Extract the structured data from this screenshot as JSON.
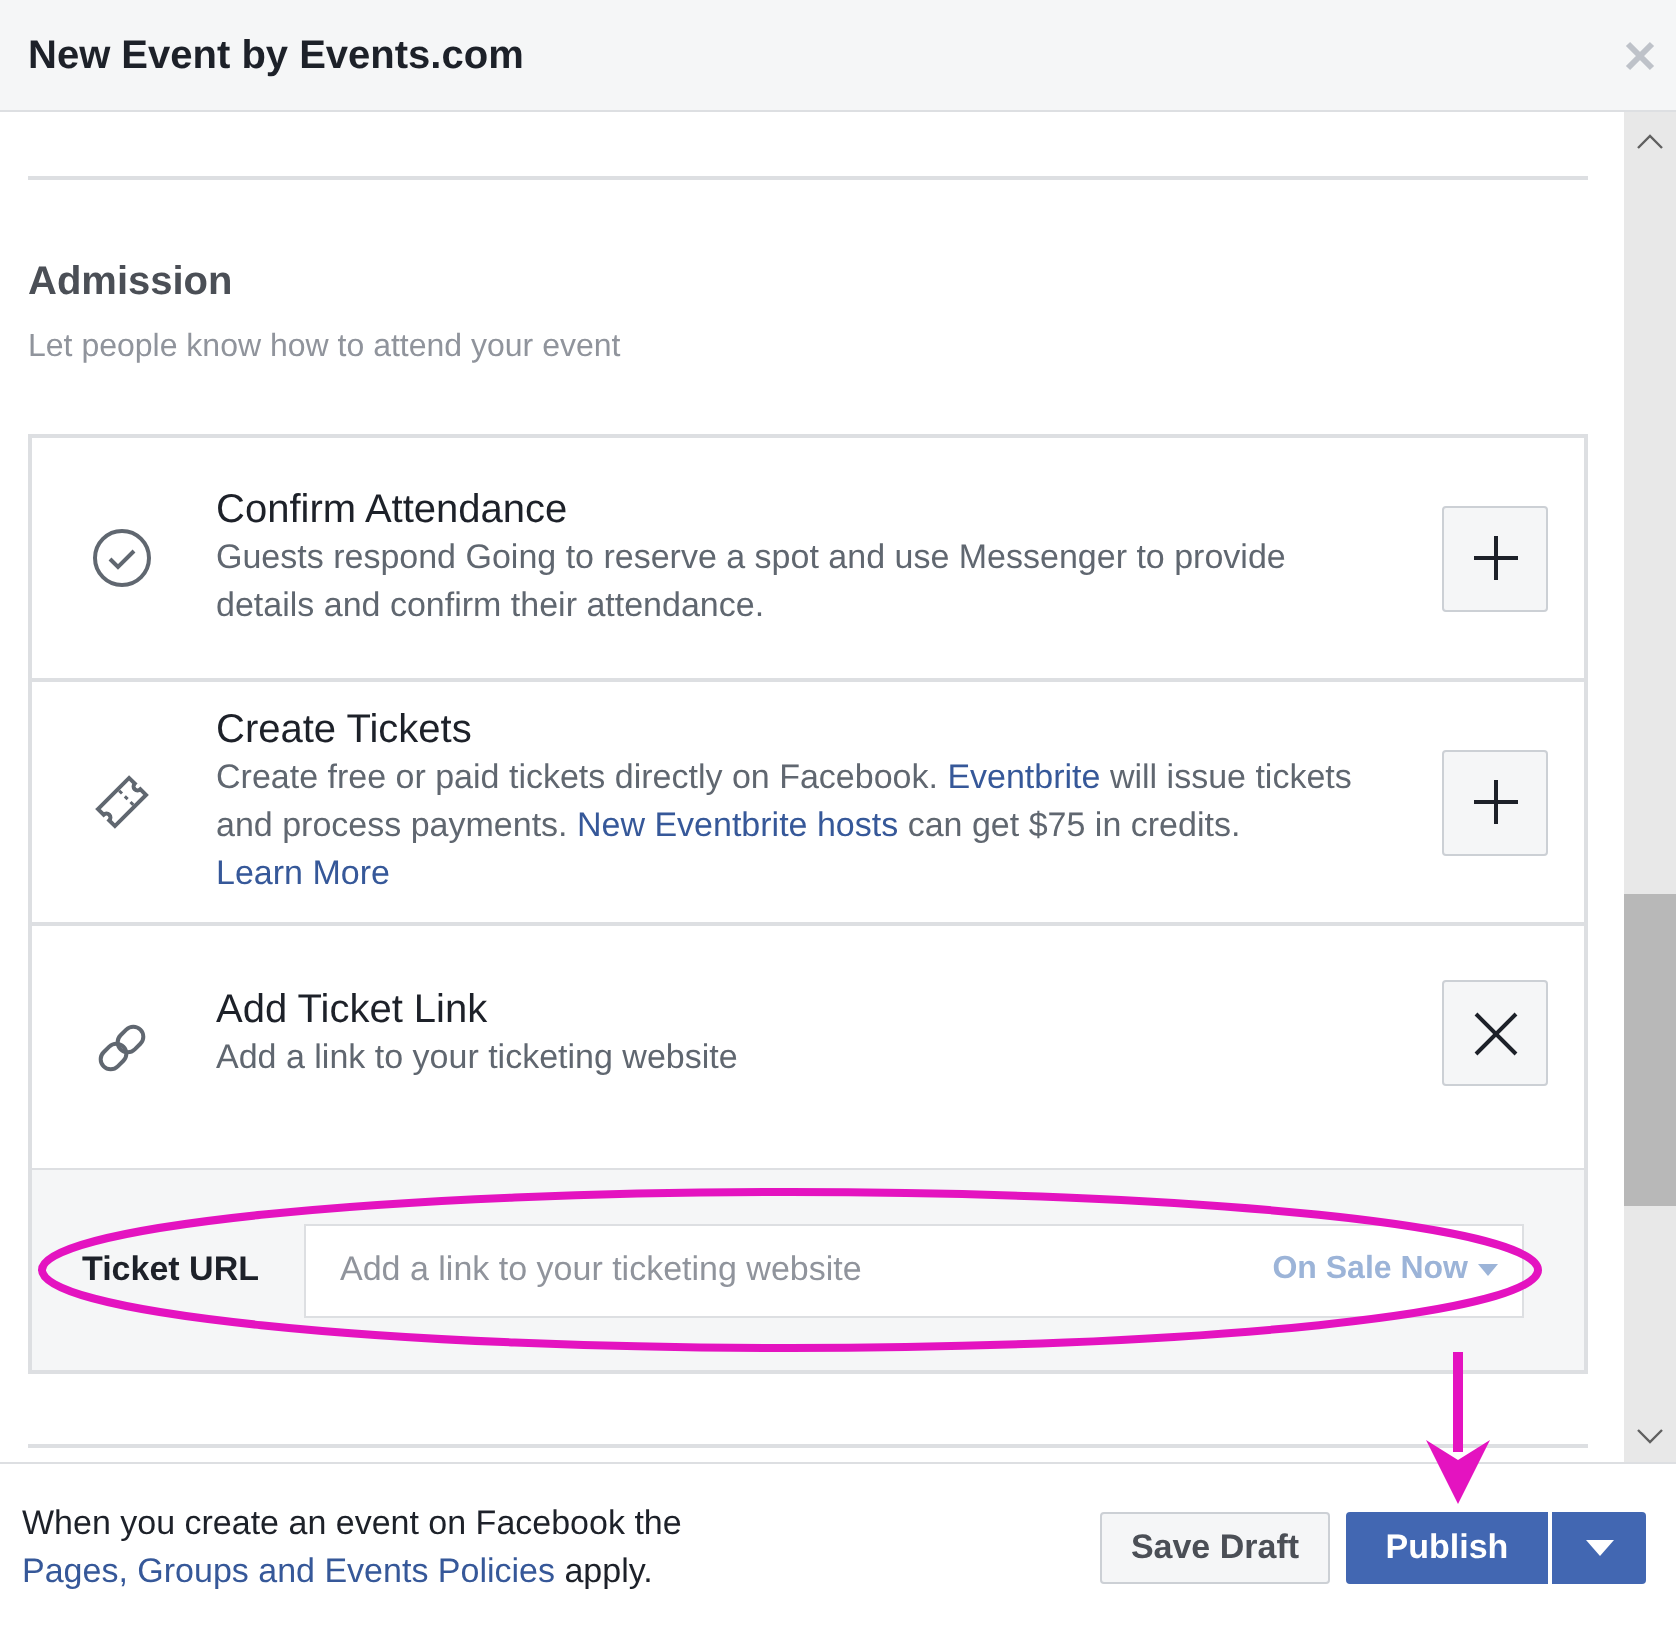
{
  "window": {
    "title": "New Event by Events.com"
  },
  "section": {
    "title": "Admission",
    "subtitle": "Let people know how to attend your event"
  },
  "options": [
    {
      "kind": "check",
      "title": "Confirm Attendance",
      "expanded": false,
      "description": [
        {
          "text": "Guests respond Going to reserve a spot and use Messenger to provide details and confirm their attendance.",
          "link": false
        }
      ]
    },
    {
      "kind": "ticket",
      "title": "Create Tickets",
      "expanded": false,
      "description": [
        {
          "text": "Create free or paid tickets directly on Facebook. ",
          "link": false
        },
        {
          "text": "Eventbrite",
          "link": true
        },
        {
          "text": " will issue tickets and process payments. ",
          "link": false
        },
        {
          "text": "New Eventbrite hosts",
          "link": true
        },
        {
          "text": " can get $75 in credits. ",
          "link": false
        },
        {
          "text": "Learn More",
          "link": true
        }
      ]
    },
    {
      "kind": "link",
      "title": "Add Ticket Link",
      "expanded": true,
      "description": [
        {
          "text": "Add a link to your ticketing website",
          "link": false
        }
      ],
      "field": {
        "label": "Ticket URL",
        "placeholder": "Add a link to your ticketing website",
        "dropdown": "On Sale Now"
      }
    }
  ],
  "footer": {
    "notice": [
      {
        "text": "When you create an event on Facebook the ",
        "link": false
      },
      {
        "text": "Pages, Groups and ",
        "link": true
      },
      {
        "text": "Events Policies",
        "link": true
      },
      {
        "text": " apply.",
        "link": false
      }
    ],
    "buttons": [
      {
        "kind": "secondary",
        "label": "Save Draft"
      },
      {
        "kind": "primary",
        "label": "Publish"
      }
    ]
  }
}
